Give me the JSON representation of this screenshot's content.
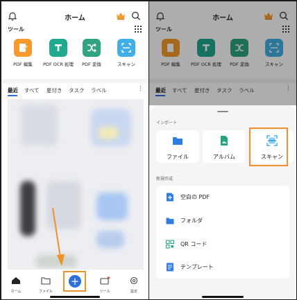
{
  "left": {
    "title": "ホーム",
    "tools_label": "ツール",
    "tools": [
      {
        "label": "PDF 編集",
        "icon": "pdf-edit-icon",
        "color": "#f59a2c"
      },
      {
        "label": "PDF OCR 処理",
        "icon": "ocr-t-icon",
        "color": "#1fa98e"
      },
      {
        "label": "PDF 変換",
        "icon": "shuffle-icon",
        "color": "#2fa382"
      },
      {
        "label": "スキャン",
        "icon": "scan-icon",
        "color": "#41aee6"
      }
    ],
    "tabs": [
      "最近",
      "すべて",
      "星付き",
      "タスク",
      "ラベル"
    ],
    "nav": [
      {
        "label": "ホーム",
        "icon": "home-icon"
      },
      {
        "label": "ファイル",
        "icon": "folder-icon"
      },
      {
        "label": "",
        "icon": "plus-icon"
      },
      {
        "label": "ツール",
        "icon": "toolbox-icon"
      },
      {
        "label": "設定",
        "icon": "gear-icon"
      }
    ],
    "accent": "#2a6fdb",
    "highlight": "#f0902b"
  },
  "right": {
    "title": "ホーム",
    "tools_label": "ツール",
    "tools": [
      "PDF 編集",
      "PDF OCR 処理",
      "PDF 変換",
      "スキャン"
    ],
    "tabs": [
      "最近",
      "すべて",
      "星付き",
      "タスク",
      "ラベル"
    ],
    "import_label": "インポート",
    "import_options": [
      "ファイル",
      "アルバム",
      "スキャン"
    ],
    "create_label": "新規作成",
    "create_options": [
      "空白の PDF",
      "フォルダ",
      "QR コード",
      "テンプレート"
    ]
  }
}
